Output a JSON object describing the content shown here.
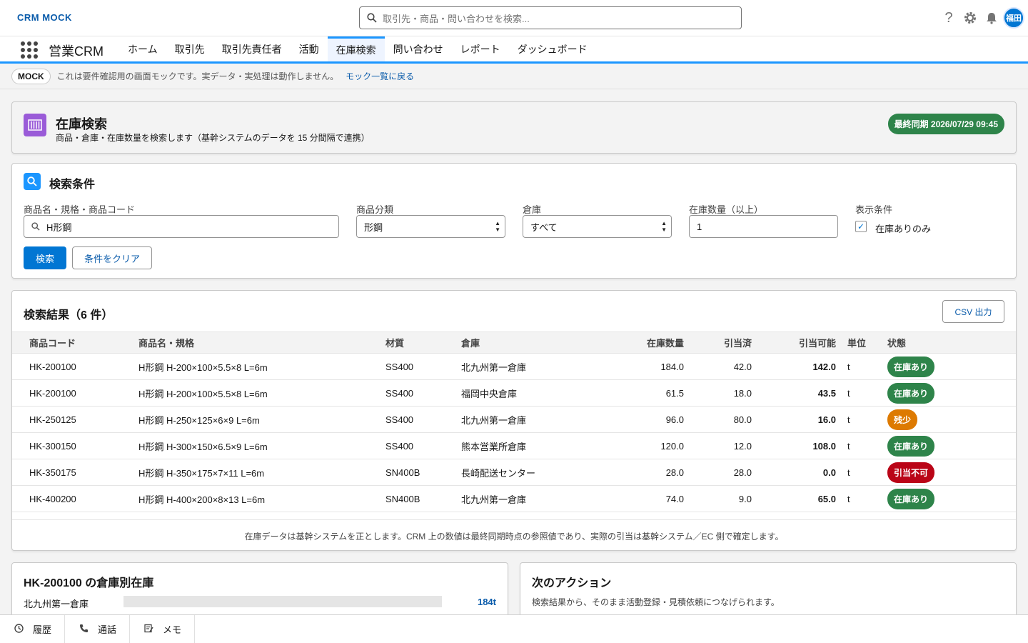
{
  "global": {
    "brand": "CRM MOCK",
    "search_placeholder": "取引先・商品・問い合わせを検索...",
    "avatar": "福田",
    "icons": [
      "help-icon",
      "gear-icon",
      "bell-icon"
    ]
  },
  "appnav": {
    "app_name": "営業CRM",
    "items": [
      "ホーム",
      "取引先",
      "取引先責任者",
      "活動",
      "在庫検索",
      "問い合わせ",
      "レポート",
      "ダッシュボード"
    ],
    "active": "在庫検索"
  },
  "banner": {
    "pill": "MOCK",
    "text": "これは要件確認用の画面モックです。実データ・実処理は動作しません。",
    "link": "モック一覧に戻る"
  },
  "page_header": {
    "title": "在庫検索",
    "subtitle": "商品・倉庫・在庫数量を検索します（基幹システムのデータを 15 分間隔で連携）",
    "sync_badge": "最終同期 2026/07/29 09:45"
  },
  "conditions": {
    "title": "検索条件",
    "product_label": "商品名・規格・商品コード",
    "product_value": "H形鋼",
    "category_label": "商品分類",
    "category_value": "形鋼",
    "warehouse_label": "倉庫",
    "warehouse_value": "すべて",
    "qty_label": "在庫数量（以上）",
    "qty_value": "1",
    "display_label": "表示条件",
    "display_checkbox": "在庫ありのみ",
    "display_checked": true,
    "search_button": "検索",
    "clear_button": "条件をクリア"
  },
  "results": {
    "title": "検索結果（6 件）",
    "csv_button": "CSV 出力",
    "columns": [
      "商品コード",
      "商品名・規格",
      "材質",
      "倉庫",
      "在庫数量",
      "引当済",
      "引当可能",
      "単位",
      "状態"
    ],
    "rows": [
      {
        "code": "HK-200100",
        "name": "H形鋼 H-200×100×5.5×8 L=6m",
        "material": "SS400",
        "warehouse": "北九州第一倉庫",
        "stock": "184.0",
        "allocated": "42.0",
        "available": "142.0",
        "unit": "t",
        "status": "在庫あり",
        "status_color": "#2e844a"
      },
      {
        "code": "HK-200100",
        "name": "H形鋼 H-200×100×5.5×8 L=6m",
        "material": "SS400",
        "warehouse": "福岡中央倉庫",
        "stock": "61.5",
        "allocated": "18.0",
        "available": "43.5",
        "unit": "t",
        "status": "在庫あり",
        "status_color": "#2e844a"
      },
      {
        "code": "HK-250125",
        "name": "H形鋼 H-250×125×6×9 L=6m",
        "material": "SS400",
        "warehouse": "北九州第一倉庫",
        "stock": "96.0",
        "allocated": "80.0",
        "available": "16.0",
        "unit": "t",
        "status": "残少",
        "status_color": "#dd7a01"
      },
      {
        "code": "HK-300150",
        "name": "H形鋼 H-300×150×6.5×9 L=6m",
        "material": "SS400",
        "warehouse": "熊本営業所倉庫",
        "stock": "120.0",
        "allocated": "12.0",
        "available": "108.0",
        "unit": "t",
        "status": "在庫あり",
        "status_color": "#2e844a"
      },
      {
        "code": "HK-350175",
        "name": "H形鋼 H-350×175×7×11 L=6m",
        "material": "SN400B",
        "warehouse": "長崎配送センター",
        "stock": "28.0",
        "allocated": "28.0",
        "available": "0.0",
        "unit": "t",
        "status": "引当不可",
        "status_color": "#ba0517"
      },
      {
        "code": "HK-400200",
        "name": "H形鋼 H-400×200×8×13 L=6m",
        "material": "SN400B",
        "warehouse": "北九州第一倉庫",
        "stock": "74.0",
        "allocated": "9.0",
        "available": "65.0",
        "unit": "t",
        "status": "在庫あり",
        "status_color": "#2e844a"
      }
    ],
    "note": "在庫データは基幹システムを正とします。CRM 上の数値は最終同期時点の参照値であり、実際の引当は基幹システム／EC 側で確定します。"
  },
  "warehouse_card": {
    "title": "HK-200100 の倉庫別在庫",
    "row_label": "北九州第一倉庫",
    "row_value": "184t"
  },
  "action_card": {
    "title": "次のアクション",
    "description": "検索結果から、そのまま活動登録・見積依頼につなげられます。"
  },
  "utility_bar": [
    "履歴",
    "通話",
    "メモ"
  ]
}
